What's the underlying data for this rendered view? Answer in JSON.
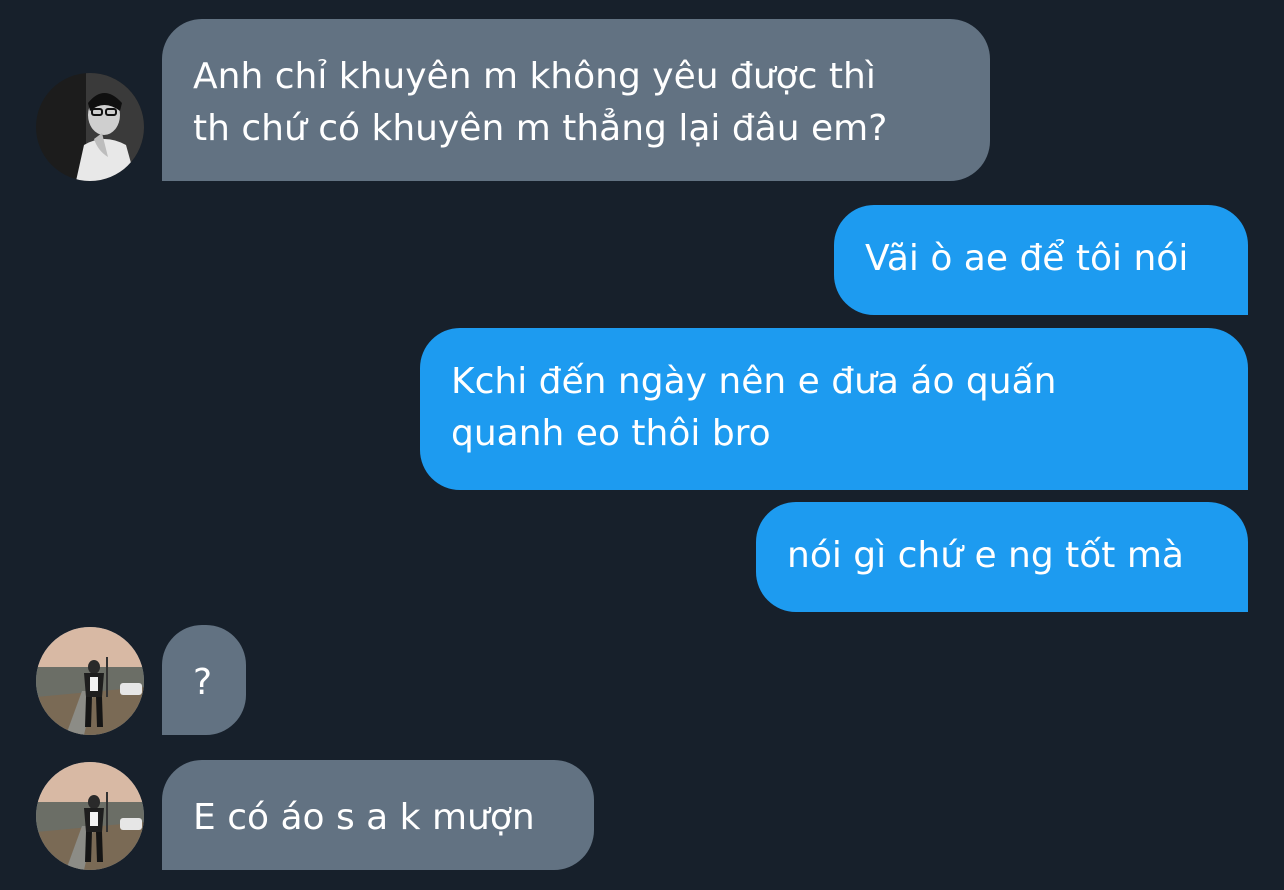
{
  "messages": [
    {
      "direction": "in",
      "lines": [
        "Anh chỉ khuyên m không yêu được thì",
        "th chứ có khuyên m thẳng lại đâu em?"
      ],
      "avatar": "profile-photo-monochrome"
    },
    {
      "direction": "out",
      "lines": [
        "Vãi ò ae để tôi nói"
      ]
    },
    {
      "direction": "out",
      "lines": [
        "Kchi đến ngày nên e đưa áo quấn",
        "quanh eo thôi bro"
      ]
    },
    {
      "direction": "out",
      "lines": [
        "nói gì chứ e ng tốt mà"
      ]
    },
    {
      "direction": "in",
      "lines": [
        "?"
      ],
      "avatar": "profile-photo-street"
    },
    {
      "direction": "in",
      "lines": [
        "E có áo s a k mượn"
      ],
      "avatar": "profile-photo-street"
    }
  ],
  "colors": {
    "background": "#17202b",
    "incoming_bubble": "#627282",
    "outgoing_bubble": "#1d9bf0",
    "text": "#ffffff"
  }
}
